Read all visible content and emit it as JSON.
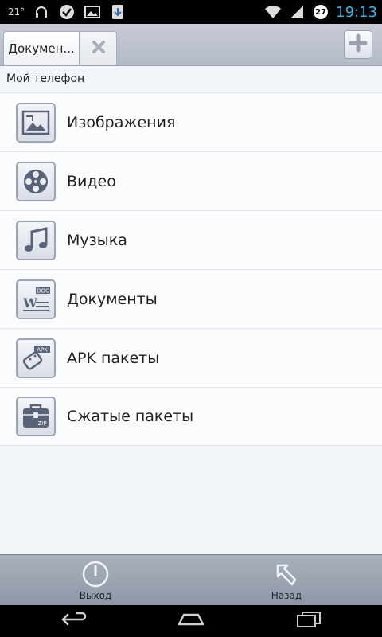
{
  "status_bar": {
    "temperature": "21°",
    "time": "19:13",
    "badge_count": "27",
    "icons": [
      "headphones-icon",
      "check-icon",
      "image-icon",
      "download-icon",
      "wifi-icon",
      "signal-icon"
    ]
  },
  "tabs": [
    {
      "label": "Докумен..."
    }
  ],
  "location": "Мой телефон",
  "categories": [
    {
      "label": "Изображения",
      "icon": "images-icon"
    },
    {
      "label": "Видео",
      "icon": "video-reel-icon"
    },
    {
      "label": "Музыка",
      "icon": "music-note-icon"
    },
    {
      "label": "Документы",
      "icon": "document-icon"
    },
    {
      "label": "APK пакеты",
      "icon": "apk-icon"
    },
    {
      "label": "Сжатые пакеты",
      "icon": "zip-icon"
    }
  ],
  "toolbar": {
    "exit_label": "Выход",
    "back_label": "Назад"
  },
  "colors": {
    "time": "#3cb7e8",
    "icon_stroke": "#5a6478"
  }
}
